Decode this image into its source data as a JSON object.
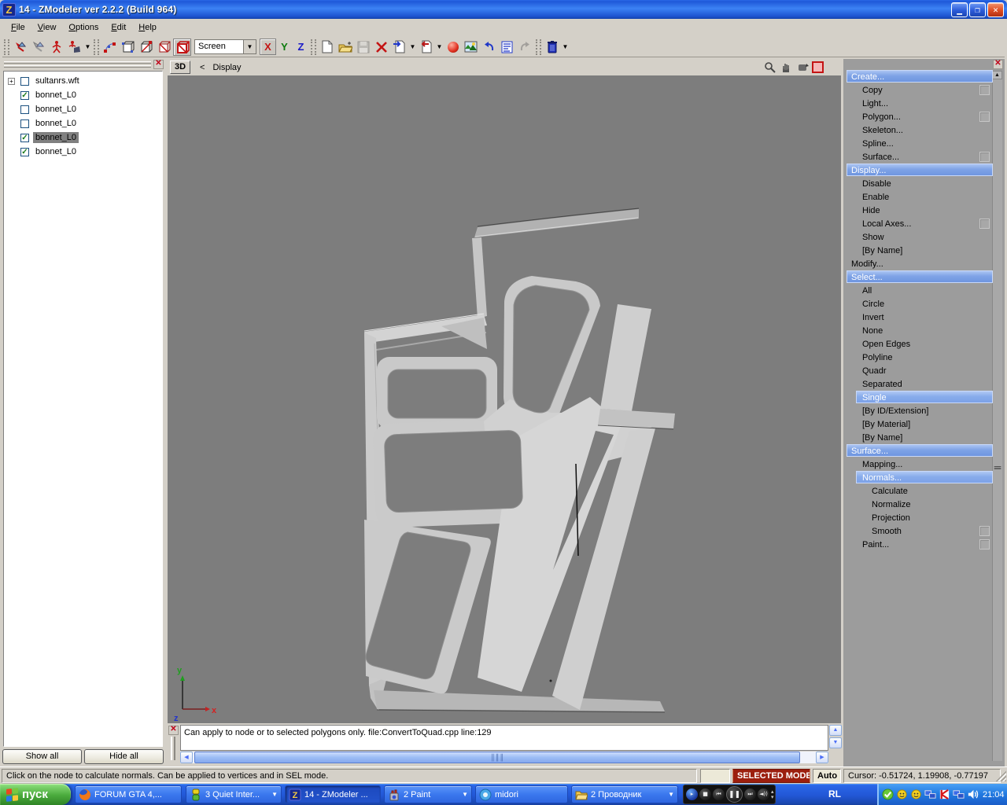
{
  "window": {
    "title": "14 - ZModeler ver 2.2.2 (Build 964)",
    "icon_letter": "Z"
  },
  "menu": {
    "items": [
      {
        "label": "File"
      },
      {
        "label": "View"
      },
      {
        "label": "Options"
      },
      {
        "label": "Edit"
      },
      {
        "label": "Help"
      }
    ]
  },
  "toolbar": {
    "screen_combo_value": "Screen",
    "axis_x": "X",
    "axis_y": "Y",
    "axis_z": "Z"
  },
  "left_panel": {
    "tree": [
      {
        "expand": "+",
        "check": "",
        "label": "sultanrs.wft"
      },
      {
        "check": "✓",
        "label": "bonnet_L0"
      },
      {
        "check": "",
        "label": "bonnet_L0"
      },
      {
        "check": "",
        "label": "bonnet_L0"
      },
      {
        "check": "✓",
        "label": "bonnet_L0"
      },
      {
        "check": "✓",
        "label": "bonnet_L0"
      }
    ],
    "show_all": "Show all",
    "hide_all": "Hide all"
  },
  "viewport": {
    "mode_button": "3D",
    "breadcrumb_back": "<",
    "breadcrumb": "Display",
    "axis_x_label": "x",
    "axis_y_label": "y",
    "axis_z_label": "z"
  },
  "right_panel": {
    "items": [
      {
        "label": "Create...",
        "kind": "header"
      },
      {
        "label": "Copy",
        "kind": "item",
        "checkbox": true
      },
      {
        "label": "Light...",
        "kind": "item"
      },
      {
        "label": "Polygon...",
        "kind": "item",
        "checkbox": true
      },
      {
        "label": "Skeleton...",
        "kind": "item"
      },
      {
        "label": "Spline...",
        "kind": "item"
      },
      {
        "label": "Surface...",
        "kind": "item",
        "checkbox": true
      },
      {
        "label": "Display...",
        "kind": "header"
      },
      {
        "label": "Disable",
        "kind": "item"
      },
      {
        "label": "Enable",
        "kind": "item"
      },
      {
        "label": "Hide",
        "kind": "item"
      },
      {
        "label": "Local Axes...",
        "kind": "item",
        "checkbox": true
      },
      {
        "label": "Show",
        "kind": "item"
      },
      {
        "label": "[By Name]",
        "kind": "item"
      },
      {
        "label": "Modify...",
        "kind": "plain"
      },
      {
        "label": "Select...",
        "kind": "header"
      },
      {
        "label": "All",
        "kind": "item"
      },
      {
        "label": "Circle",
        "kind": "item"
      },
      {
        "label": "Invert",
        "kind": "item"
      },
      {
        "label": "None",
        "kind": "item"
      },
      {
        "label": "Open Edges",
        "kind": "item"
      },
      {
        "label": "Polyline",
        "kind": "item"
      },
      {
        "label": "Quadr",
        "kind": "item"
      },
      {
        "label": "Separated",
        "kind": "item"
      },
      {
        "label": "Single",
        "kind": "selected"
      },
      {
        "label": "[By ID/Extension]",
        "kind": "item"
      },
      {
        "label": "[By Material]",
        "kind": "item"
      },
      {
        "label": "[By Name]",
        "kind": "item"
      },
      {
        "label": "Surface...",
        "kind": "header"
      },
      {
        "label": "Mapping...",
        "kind": "item"
      },
      {
        "label": "Normals...",
        "kind": "selected"
      },
      {
        "label": "Calculate",
        "kind": "sub"
      },
      {
        "label": "Normalize",
        "kind": "sub"
      },
      {
        "label": "Projection",
        "kind": "sub"
      },
      {
        "label": "Smooth",
        "kind": "sub",
        "checkbox": true
      },
      {
        "label": "Paint...",
        "kind": "item",
        "checkbox": true
      }
    ]
  },
  "log": {
    "message": "Can apply to node or to selected polygons only. file:ConvertToQuad.cpp line:129"
  },
  "status_bar": {
    "hint": "Click on the node to calculate normals. Can be applied to vertices and in SEL mode.",
    "mode_badge": "SELECTED MODE",
    "auto_label": "Auto",
    "cursor_readout": "Cursor: -0.51724, 1.19908, -0.77197"
  },
  "taskbar": {
    "start_label": "пуск",
    "buttons": [
      {
        "label": "FORUM GTA 4,..."
      },
      {
        "label": "3 Quiet Inter..."
      },
      {
        "label": "14 - ZModeler ..."
      },
      {
        "label": "2 Paint"
      },
      {
        "label": "midori"
      },
      {
        "label": "2 Проводник"
      }
    ],
    "language_indicator": "RL",
    "clock": "21:04"
  },
  "colors": {
    "titlebar_blue": "#1e55d2",
    "taskbar_blue": "#2257d6",
    "start_green": "#4aaa3c",
    "selected_mode_red": "#9c1f0e",
    "panel_header_blue": "#7fa3e6",
    "viewport_gray": "#7d7d7d",
    "model_light_gray": "#cccccc"
  }
}
